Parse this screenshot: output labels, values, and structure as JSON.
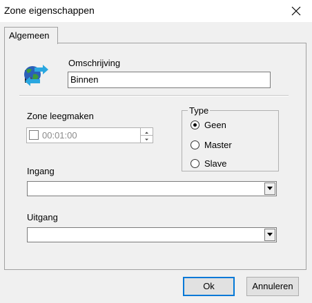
{
  "window": {
    "title": "Zone eigenschappen"
  },
  "tabs": [
    {
      "label": "Algemeen",
      "active": true
    }
  ],
  "description": {
    "label": "Omschrijving",
    "value": "Binnen"
  },
  "clear_zone": {
    "label": "Zone leegmaken",
    "time_value": "00:01:00",
    "checked": false,
    "enabled": false
  },
  "type_group": {
    "title": "Type",
    "options": [
      {
        "label": "Geen",
        "selected": true
      },
      {
        "label": "Master",
        "selected": false
      },
      {
        "label": "Slave",
        "selected": false
      }
    ]
  },
  "input": {
    "label": "Ingang",
    "value": ""
  },
  "output": {
    "label": "Uitgang",
    "value": ""
  },
  "buttons": {
    "ok": "Ok",
    "cancel": "Annuleren"
  },
  "icons": {
    "app": "globe-arrows-icon",
    "close": "close-icon",
    "dropdown": "chevron-down-icon"
  },
  "colors": {
    "focus_border": "#0078d7",
    "disabled_text": "#8a8a8a"
  }
}
